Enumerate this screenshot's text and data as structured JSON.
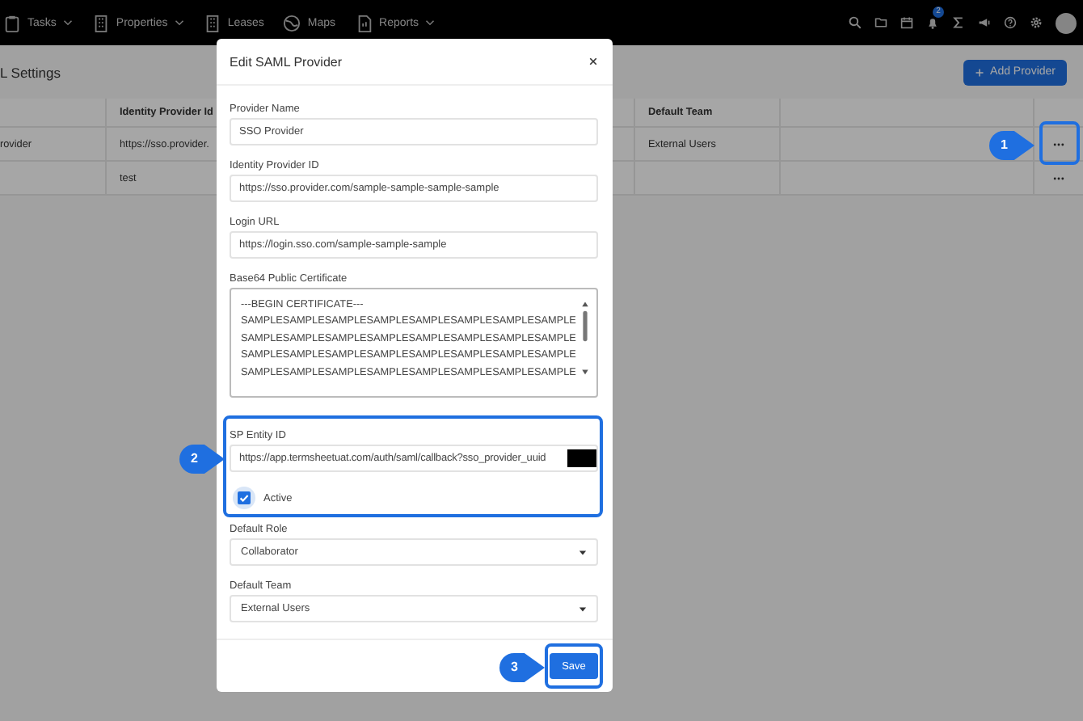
{
  "nav": {
    "items": [
      {
        "label": "Tasks",
        "kind": "clipboard",
        "dropdown": true
      },
      {
        "label": "Properties",
        "kind": "building",
        "dropdown": true
      },
      {
        "label": "Leases",
        "kind": "building",
        "dropdown": false
      },
      {
        "label": "Maps",
        "kind": "globe",
        "dropdown": false
      },
      {
        "label": "Reports",
        "kind": "document",
        "dropdown": true
      }
    ],
    "notification_count": "2"
  },
  "page": {
    "title": "L Settings",
    "add_button": "Add Provider",
    "table": {
      "columns": [
        "Identity Provider Id",
        "Default Team"
      ],
      "rows": [
        {
          "name": "rovider",
          "identity_provider_id": "https://sso.provider.",
          "default_team": "External Users"
        },
        {
          "identity_provider_id": "test"
        }
      ]
    }
  },
  "modal": {
    "title": "Edit SAML Provider",
    "fields": [
      {
        "label": "Provider Name",
        "value": "SSO Provider"
      },
      {
        "label": "Identity Provider ID",
        "value": "https://sso.provider.com/sample-sample-sample-sample"
      },
      {
        "label": "Login URL",
        "value": "https://login.sso.com/sample-sample-sample"
      }
    ],
    "certificate": {
      "label": "Base64 Public Certificate",
      "lines": [
        "---BEGIN CERTIFICATE---",
        "SAMPLESAMPLESAMPLESAMPLESAMPLESAMPLESAMPLESAMPLE",
        "SAMPLESAMPLESAMPLESAMPLESAMPLESAMPLESAMPLESAMPLE",
        "SAMPLESAMPLESAMPLESAMPLESAMPLESAMPLESAMPLESAMPLE",
        "SAMPLESAMPLESAMPLESAMPLESAMPLESAMPLESAMPLESAMPLE"
      ]
    },
    "sp_entity": {
      "label": "SP Entity ID",
      "value": "https://app.termsheetuat.com/auth/saml/callback?sso_provider_uuid",
      "redacted": true
    },
    "active": {
      "label": "Active",
      "checked": true
    },
    "selects": [
      {
        "label": "Default Role",
        "value": "Collaborator"
      },
      {
        "label": "Default Team",
        "value": "External Users"
      }
    ],
    "save_button": "Save"
  },
  "callouts": [
    {
      "number": "1"
    },
    {
      "number": "2"
    },
    {
      "number": "3"
    }
  ]
}
